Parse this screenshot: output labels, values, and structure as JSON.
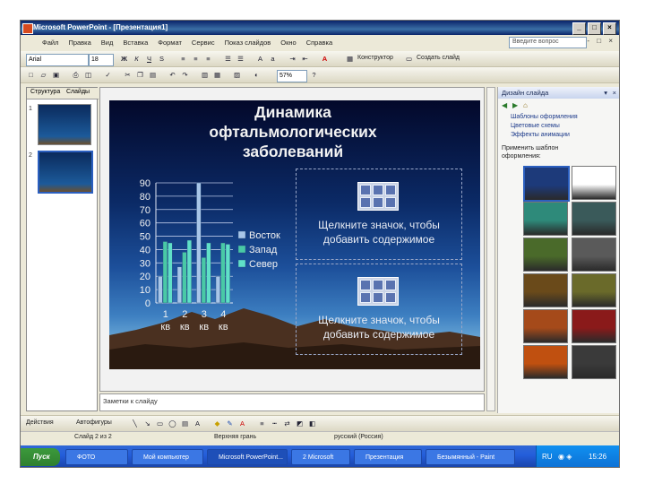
{
  "window": {
    "title": "Microsoft PowerPoint - [Презентация1]",
    "controls": [
      "_",
      "□",
      "×"
    ]
  },
  "menu": {
    "items": [
      "Файл",
      "Правка",
      "Вид",
      "Вставка",
      "Формат",
      "Сервис",
      "Показ слайдов",
      "Окно",
      "Справка"
    ],
    "help_placeholder": "Введите вопрос",
    "mdi_controls": "- □ ×"
  },
  "format_toolbar": {
    "font": "Arial",
    "size": "18",
    "bold": "Ж",
    "italic": "К",
    "underline": "Ч",
    "shadow": "S",
    "designer": "Конструктор",
    "new_slide": "Создать слайд"
  },
  "standard_toolbar": {
    "zoom": "57%"
  },
  "outline": {
    "tabs": [
      "Структура",
      "Слайды"
    ],
    "slide_numbers": [
      "1",
      "2"
    ]
  },
  "slide": {
    "title_lines": [
      "Динамика",
      "офтальмологических",
      "заболеваний"
    ],
    "placeholder_text_lines": [
      "Щелкните значок, чтобы",
      "добавить содержимое"
    ]
  },
  "chart_data": {
    "type": "bar",
    "categories": [
      "1 кв",
      "2 кв",
      "3 кв",
      "4 кв"
    ],
    "category_lines": [
      [
        "1",
        "кв"
      ],
      [
        "2",
        "кв"
      ],
      [
        "3",
        "кв"
      ],
      [
        "4",
        "кв"
      ]
    ],
    "series": [
      {
        "name": "Восток",
        "values": [
          20,
          27,
          90,
          20
        ]
      },
      {
        "name": "Запад",
        "values": [
          46,
          38,
          34,
          45
        ]
      },
      {
        "name": "Север",
        "values": [
          45,
          47,
          45,
          44
        ]
      }
    ],
    "ylim": [
      0,
      90
    ],
    "yticks": [
      0,
      10,
      20,
      30,
      40,
      50,
      60,
      70,
      80,
      90
    ],
    "legend_position": "right",
    "grid": true,
    "colors": {
      "series": [
        "#a8c6e8",
        "#49c9a6",
        "#60e0c8"
      ]
    }
  },
  "notes": {
    "placeholder": "Заметки к слайду"
  },
  "taskpane": {
    "title": "Дизайн слайда",
    "links": [
      "Шаблоны оформления",
      "Цветовые схемы",
      "Эффекты анимации"
    ],
    "apply_label_lines": [
      "Применить шаблон",
      "оформления:"
    ],
    "scheme_colors": [
      "#1d3a7a",
      "#ffffff",
      "#2e8a7a",
      "#3a5a5a",
      "#4a6a2a",
      "#5a5a5a",
      "#6a4a1a",
      "#6a6a2a",
      "#a54a1a",
      "#8a1a1a",
      "#c05010",
      "#3a3a3a"
    ]
  },
  "drawing_toolbar": {
    "actions": "Действия",
    "autoshapes": "Автофигуры"
  },
  "status": {
    "slide": "Слайд 2 из 2",
    "design": "Верхняя грань",
    "language": "русский (Россия)"
  },
  "taskbar": {
    "start": "Пуск",
    "buttons": [
      "ФОТО",
      "Мой компьютер",
      "Microsoft PowerPoint...",
      "2 Microsoft",
      "Презентация",
      "Безымянный - Paint"
    ],
    "clock": "15:26"
  }
}
